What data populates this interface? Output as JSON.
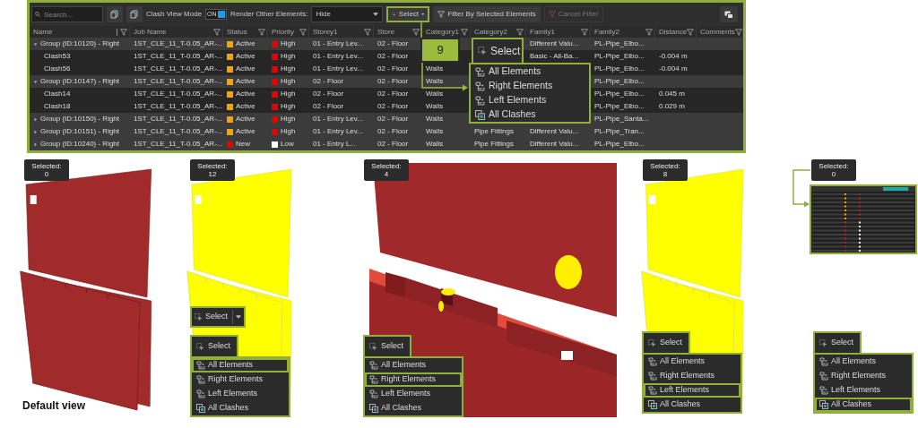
{
  "toolbar": {
    "search": {
      "placeholder": "Search..."
    },
    "clash_view_mode": {
      "label": "Clash View Mode",
      "toggle_text": "ON",
      "on": true
    },
    "render_other_elements": {
      "label": "Render Other Elements:",
      "value": "Hide"
    },
    "select_button": {
      "label": "Select",
      "highlighted": true
    },
    "filter_button": {
      "label": "Filter By Selected Elements"
    },
    "cancel_filter": {
      "label": "Cancel Filter",
      "disabled": true
    }
  },
  "table": {
    "columns": [
      "Name",
      "Job Name",
      "Status",
      "Priority",
      "Storey1",
      "Store",
      "Category1",
      "Category2",
      "Family1",
      "Family2",
      "Distance",
      "Comments"
    ],
    "rows": [
      {
        "name": "Group (ID:10120) - Right",
        "expanded": true,
        "job_name": "1ST_CLE_11_T-0.05_AR-...",
        "status": {
          "label": "Active",
          "color": "#f5a300"
        },
        "priority": {
          "label": "High",
          "color": "#e60000"
        },
        "storey1": "01 - Entry Lev...",
        "storey2": "02 - Floor",
        "family1": "Different Valu...",
        "family2": "PL-Pipe_Elbo...",
        "children": [
          {
            "name": "Clash53",
            "job_name": "1ST_CLE_11_T-0.05_AR-...",
            "status": {
              "label": "Active",
              "color": "#f5a300"
            },
            "priority": {
              "label": "High",
              "color": "#e60000"
            },
            "storey1": "01 - Entry Lev...",
            "storey2": "02 - Floor",
            "family1": "Basic - All-Ba...",
            "family2": "PL-Pipe_Elbo...",
            "distance": "-0.004 m"
          },
          {
            "name": "Clash56",
            "job_name": "1ST_CLE_11_T-0.05_AR-...",
            "status": {
              "label": "Active",
              "color": "#f5a300"
            },
            "priority": {
              "label": "High",
              "color": "#e60000"
            },
            "storey1": "01 - Entry Lev...",
            "storey2": "02 - Floor",
            "category1": "Walls",
            "family2": "PL-Pipe_Elbo...",
            "distance": "-0.004 m"
          }
        ]
      },
      {
        "name": "Group (ID:10147) - Right",
        "expanded": true,
        "job_name": "1ST_CLE_11_T-0.05_AR-...",
        "status": {
          "label": "Active",
          "color": "#f5a300"
        },
        "priority": {
          "label": "High",
          "color": "#e60000"
        },
        "storey1": "02 - Floor",
        "storey2": "02 - Floor",
        "category1": "Walls",
        "family2": "PL-Pipe_Elbo...",
        "children": [
          {
            "name": "Clash14",
            "job_name": "1ST_CLE_11_T-0.05_AR-...",
            "status": {
              "label": "Active",
              "color": "#f5a300"
            },
            "priority": {
              "label": "High",
              "color": "#e60000"
            },
            "storey1": "02 - Floor",
            "storey2": "02 - Floor",
            "category1": "Walls",
            "family2": "PL-Pipe_Elbo...",
            "distance": "0.045 m"
          },
          {
            "name": "Clash18",
            "job_name": "1ST_CLE_11_T-0.05_AR-...",
            "status": {
              "label": "Active",
              "color": "#f5a300"
            },
            "priority": {
              "label": "High",
              "color": "#e60000"
            },
            "storey1": "02 - Floor",
            "storey2": "02 - Floor",
            "category1": "Walls",
            "family2": "PL-Pipe_Elbo...",
            "distance": "0.029 m"
          }
        ]
      },
      {
        "name": "Group (ID:10150) - Right",
        "expanded": false,
        "job_name": "1ST_CLE_11_T-0.05_AR-...",
        "status": {
          "label": "Active",
          "color": "#f5a300"
        },
        "priority": {
          "label": "High",
          "color": "#e60000"
        },
        "storey1": "01 - Entry Lev...",
        "storey2": "02 - Floor",
        "category1": "Walls",
        "family2": "PL-Pipe_Santa..."
      },
      {
        "name": "Group (ID:10151) - Right",
        "expanded": false,
        "job_name": "1ST_CLE_11_T-0.05_AR-...",
        "status": {
          "label": "Active",
          "color": "#f5a300"
        },
        "priority": {
          "label": "High",
          "color": "#e60000"
        },
        "storey1": "01 - Entry Lev...",
        "storey2": "02 - Floor",
        "category1": "Walls",
        "category2": "Pipe Fittings",
        "family1": "Different Valu...",
        "family2": "PL-Pipe_Tran..."
      },
      {
        "name": "Group (ID:10240) - Right",
        "expanded": false,
        "job_name": "1ST_CLE_11_T-0.05_AR-...",
        "status": {
          "label": "New",
          "color": "#e60000"
        },
        "priority": {
          "label": "Low",
          "color": "#ffffff"
        },
        "storey1": "01 - Entry L...",
        "storey2": "02 - Floor",
        "category1": "Walls",
        "category2": "Pipe Fittings",
        "family1": "Different Valu...",
        "family2": "PL-Pipe_Elbo..."
      }
    ]
  },
  "callout": {
    "number": "9"
  },
  "dropdown": {
    "title": "Select",
    "items": [
      {
        "label": "All Elements",
        "kind": "elements"
      },
      {
        "label": "Right Elements",
        "kind": "elements"
      },
      {
        "label": "Left Elements",
        "kind": "elements"
      },
      {
        "label": "All Clashes",
        "kind": "clashes"
      }
    ]
  },
  "views": [
    {
      "kind": "default",
      "selected_label": "Selected:",
      "selected_count": "0",
      "caption": "Default view"
    },
    {
      "kind": "highlighted",
      "selected_label": "Selected:",
      "selected_count": "12",
      "split_button": {
        "label": "Select"
      },
      "menu": {
        "title": "Select",
        "items": [
          {
            "label": "All Elements",
            "kind": "elements",
            "selected": true
          },
          {
            "label": "Right Elements",
            "kind": "elements",
            "selected": false
          },
          {
            "label": "Left Elements",
            "kind": "elements",
            "selected": false
          },
          {
            "label": "All Clashes",
            "kind": "clashes",
            "selected": false
          }
        ]
      }
    },
    {
      "kind": "closeup",
      "selected_label": "Selected:",
      "selected_count": "4",
      "menu": {
        "title": "Select",
        "items": [
          {
            "label": "All Elements",
            "kind": "elements",
            "selected": false
          },
          {
            "label": "Right Elements",
            "kind": "elements",
            "selected": true
          },
          {
            "label": "Left Elements",
            "kind": "elements",
            "selected": false
          },
          {
            "label": "All Clashes",
            "kind": "clashes",
            "selected": false
          }
        ]
      }
    },
    {
      "kind": "highlighted",
      "selected_label": "Selected:",
      "selected_count": "8",
      "menu": {
        "title": "Select",
        "items": [
          {
            "label": "All Elements",
            "kind": "elements",
            "selected": false
          },
          {
            "label": "Right Elements",
            "kind": "elements",
            "selected": false
          },
          {
            "label": "Left Elements",
            "kind": "elements",
            "selected": true
          },
          {
            "label": "All Clashes",
            "kind": "clashes",
            "selected": false
          }
        ]
      }
    },
    {
      "kind": "table_thumbnail",
      "selected_label": "Selected:",
      "selected_count": "0",
      "menu": {
        "title": "Select",
        "items": [
          {
            "label": "All Elements",
            "kind": "elements",
            "selected": false
          },
          {
            "label": "Right Elements",
            "kind": "elements",
            "selected": false
          },
          {
            "label": "Left Elements",
            "kind": "elements",
            "selected": false
          },
          {
            "label": "All Clashes",
            "kind": "clashes",
            "selected": true
          }
        ]
      }
    }
  ]
}
